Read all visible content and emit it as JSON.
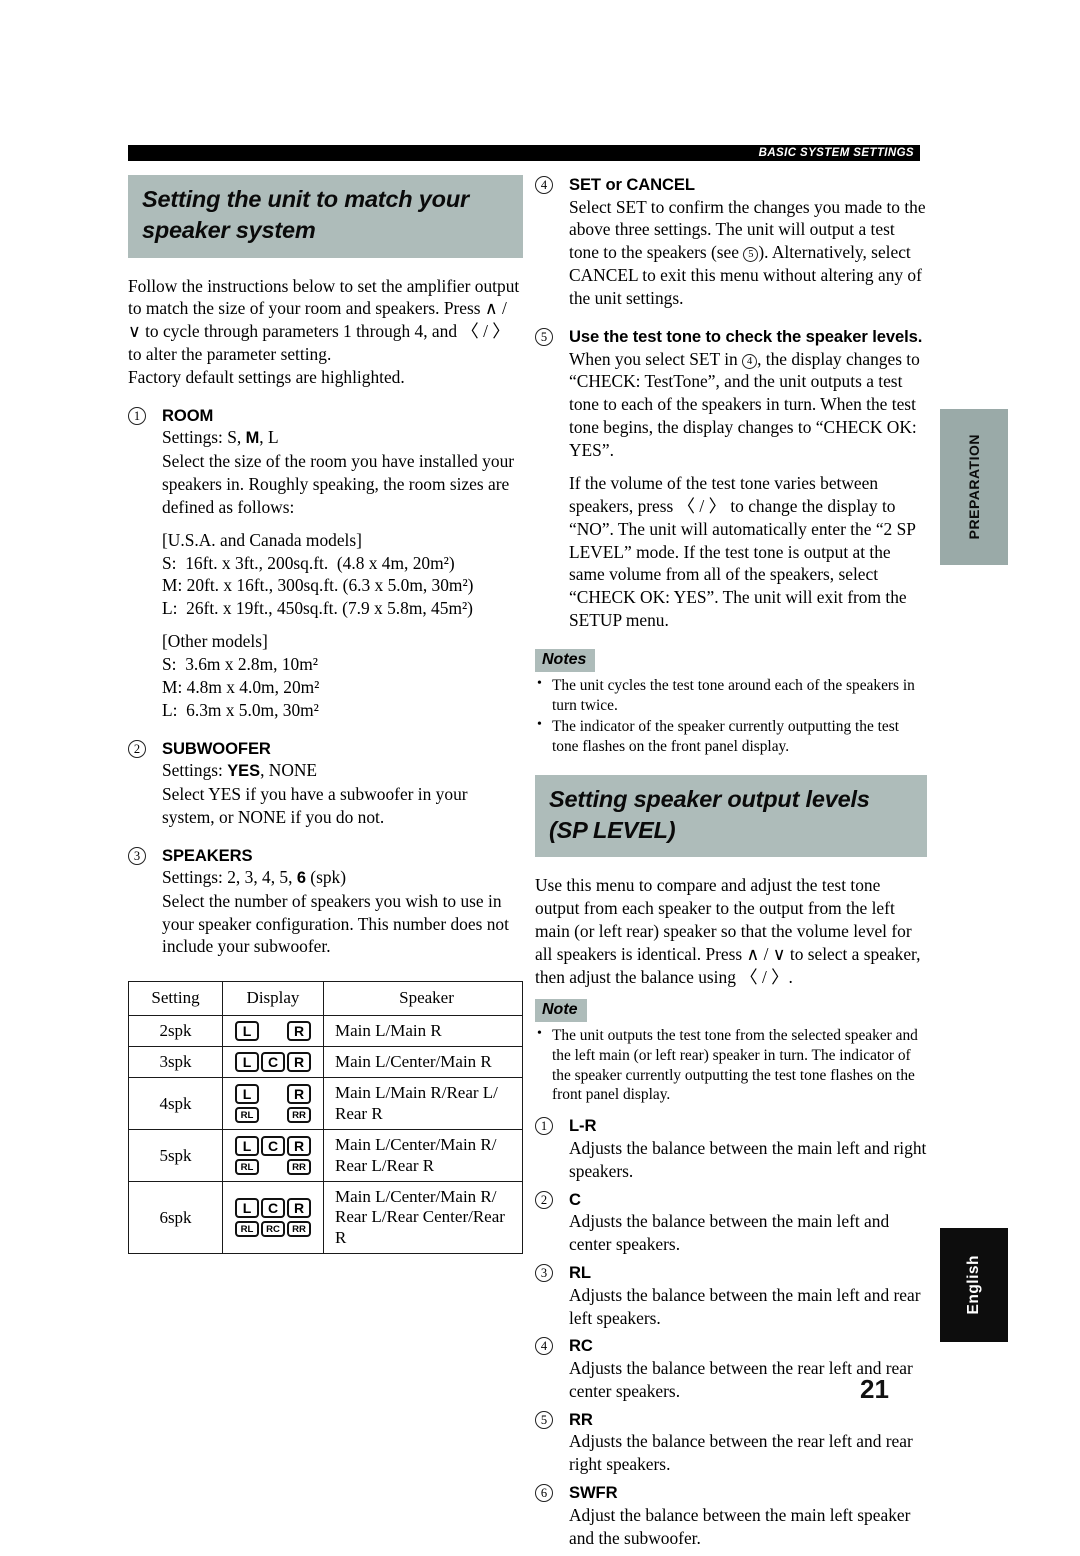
{
  "header": {
    "running_head": "BASIC SYSTEM SETTINGS"
  },
  "page_number": "21",
  "side_tabs": {
    "preparation": "PREPARATION",
    "language": "English"
  },
  "left_column": {
    "banner_line1": "Setting the unit to match your",
    "banner_line2": "speaker system",
    "intro": "Follow the instructions below to set the amplifier output to match the size of your room and speakers. Press ∧ / ∨ to cycle through parameters 1 through 4, and 〈 / 〉 to alter the parameter setting.",
    "intro2": "Factory default settings are highlighted.",
    "items": [
      {
        "number": "1",
        "title": "ROOM",
        "settings_label": "Settings:",
        "settings_options": "S, M, L",
        "settings_default": "M",
        "body": "Select the size of the room you have installed your speakers in. Roughly speaking, the room sizes are defined as follows:",
        "group1_heading": "[U.S.A. and Canada models]",
        "group1_lines": [
          "S:  16ft. x 3ft., 200sq.ft.  (4.8 x 4m, 20m²)",
          "M: 20ft. x 16ft., 300sq.ft. (6.3 x 5.0m, 30m²)",
          "L:  26ft. x 19ft., 450sq.ft. (7.9 x 5.8m, 45m²)"
        ],
        "group2_heading": "[Other models]",
        "group2_lines": [
          "S:  3.6m x 2.8m, 10m²",
          "M: 4.8m x 4.0m, 20m²",
          "L:  6.3m x 5.0m, 30m²"
        ]
      },
      {
        "number": "2",
        "title": "SUBWOOFER",
        "settings_label": "Settings:",
        "settings_default": "YES",
        "settings_rest": ", NONE",
        "body": "Select YES if you have a subwoofer in your system, or NONE if you do not."
      },
      {
        "number": "3",
        "title": "SPEAKERS",
        "settings_label": "Settings:",
        "settings_pre": " 2, 3, 4, 5, ",
        "settings_default": "6",
        "settings_rest": " (spk)",
        "body": "Select the number of speakers you wish to use in your speaker configuration. This number does not include your subwoofer."
      }
    ],
    "table": {
      "columns": [
        "Setting",
        "Display",
        "Speaker"
      ],
      "rows": [
        {
          "setting": "2spk",
          "display_top": [
            "L",
            "",
            "R"
          ],
          "display_bottom": [],
          "speaker": "Main L/Main R"
        },
        {
          "setting": "3spk",
          "display_top": [
            "L",
            "C",
            "R"
          ],
          "display_bottom": [],
          "speaker": "Main L/Center/Main R"
        },
        {
          "setting": "4spk",
          "display_top": [
            "L",
            "",
            "R"
          ],
          "display_bottom": [
            "RL",
            "",
            "RR"
          ],
          "speaker": "Main L/Main R/Rear L/ Rear R"
        },
        {
          "setting": "5spk",
          "display_top": [
            "L",
            "C",
            "R"
          ],
          "display_bottom": [
            "RL",
            "",
            "RR"
          ],
          "speaker": "Main L/Center/Main R/ Rear L/Rear R"
        },
        {
          "setting": "6spk",
          "display_top": [
            "L",
            "C",
            "R"
          ],
          "display_bottom": [
            "RL",
            "RC",
            "RR"
          ],
          "speaker": "Main L/Center/Main R/ Rear L/Rear Center/Rear R"
        }
      ]
    }
  },
  "right_column": {
    "item4": {
      "number": "4",
      "title": "SET or CANCEL",
      "body_a": "Select SET to confirm the changes you made to the above three settings. The unit will output a test tone to the speakers (see ",
      "body_ref": "5",
      "body_b": "). Alternatively, select CANCEL to exit this menu without altering any of the unit settings."
    },
    "item5": {
      "number": "5",
      "title": "Use the test tone to check the speaker levels.",
      "body_a": "When you select SET in ",
      "body_ref": "4",
      "body_b": ", the display changes to “CHECK: TestTone”, and the unit outputs a test tone to each of the speakers in turn. When the test tone begins, the display changes to “CHECK OK: YES”.",
      "body_c": "If the volume of the test tone varies between speakers, press 〈 / 〉 to change the display to “NO”. The unit will automatically enter the “2 SP LEVEL” mode. If the test tone is output at the same volume from all of the speakers, select “CHECK OK: YES”. The unit will exit from the SETUP menu."
    },
    "notes": {
      "tag": "Notes",
      "items": [
        "The unit cycles the test tone around each of the speakers in turn twice.",
        "The indicator of the speaker currently outputting the test tone flashes on the front panel display."
      ]
    },
    "banner_line1": "Setting speaker output levels",
    "banner_line2": "(SP LEVEL)",
    "sp_intro": "Use this menu to compare and adjust the test tone output from each speaker to the output from the left main (or left rear) speaker so that the volume level for all speakers is identical. Press ∧ / ∨ to select a speaker, then adjust the balance using 〈 / 〉.",
    "note": {
      "tag": "Note",
      "items": [
        "The unit outputs the test tone from the selected speaker and the left main (or left rear) speaker in turn. The indicator of the speaker currently outputting the test tone flashes on the front panel display."
      ]
    },
    "level_items": [
      {
        "number": "1",
        "title": "L-R",
        "body": "Adjusts the balance between the main left and right speakers."
      },
      {
        "number": "2",
        "title": "C",
        "body": "Adjusts the balance between the main left and center speakers."
      },
      {
        "number": "3",
        "title": "RL",
        "body": "Adjusts the balance between the main left and rear left speakers."
      },
      {
        "number": "4",
        "title": "RC",
        "body": "Adjusts the balance between the rear left and rear center speakers."
      },
      {
        "number": "5",
        "title": "RR",
        "body": "Adjusts the balance between the rear left and rear right speakers."
      },
      {
        "number": "6",
        "title": "SWFR",
        "body": "Adjust the balance between the main left speaker and the subwoofer."
      }
    ]
  },
  "colors": {
    "banner_gray": "#aebcba",
    "tab_gray": "#9aaaa8",
    "tab_black": "#0d0d0d",
    "rule_black": "#000000"
  }
}
